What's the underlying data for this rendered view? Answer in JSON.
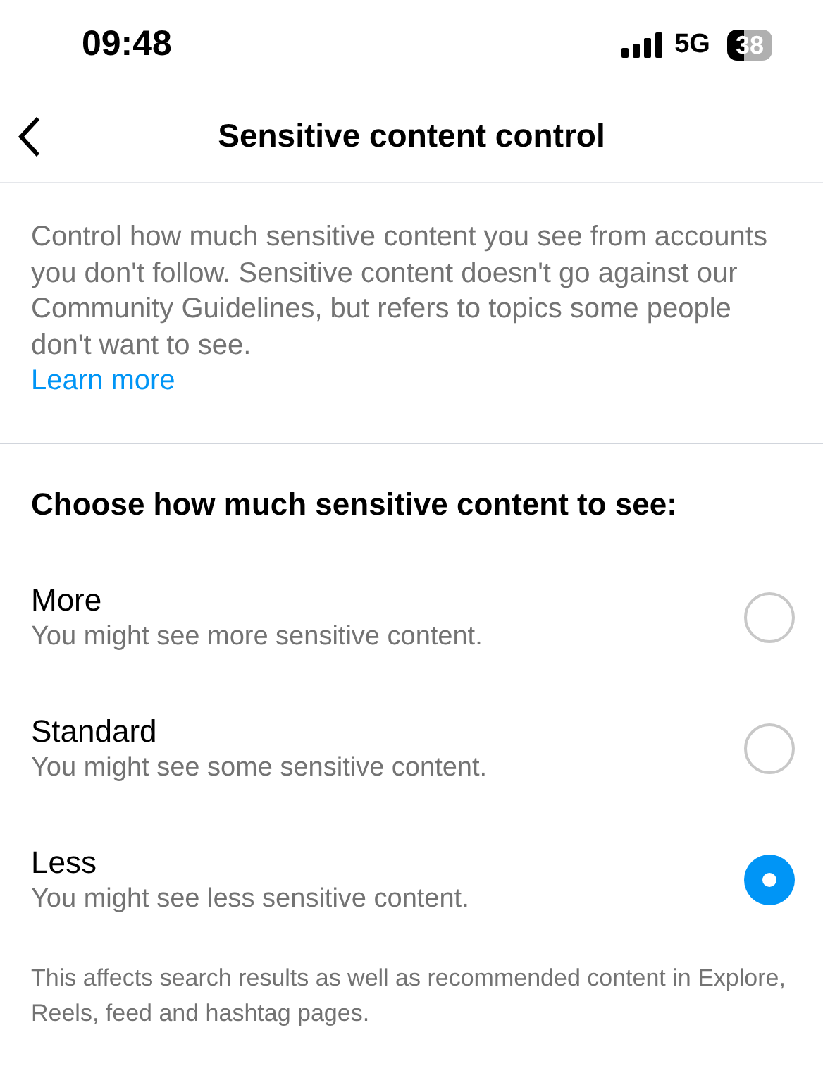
{
  "status_bar": {
    "time": "09:48",
    "network": "5G",
    "battery": "38"
  },
  "header": {
    "title": "Sensitive content control"
  },
  "description": {
    "text": "Control how much sensitive content you see from accounts you don't follow. Sensitive content doesn't go against our Community Guidelines, but refers to topics some people don't want to see.",
    "link": "Learn more"
  },
  "heading": "Choose how much sensitive content to see:",
  "options": [
    {
      "label": "More",
      "hint": "You might see more sensitive content.",
      "selected": false
    },
    {
      "label": "Standard",
      "hint": "You might see some sensitive content.",
      "selected": false
    },
    {
      "label": "Less",
      "hint": "You might see less sensitive content.",
      "selected": true
    }
  ],
  "footer": "This affects search results as well as recommended content in Explore, Reels, feed and hashtag pages."
}
